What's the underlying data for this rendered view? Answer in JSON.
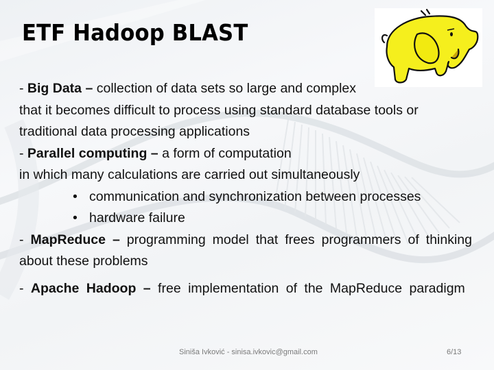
{
  "slide": {
    "title": "ETF Hadoop BLAST",
    "logo": {
      "icon": "hadoop-elephant-icon",
      "color": "#f5ef1d"
    },
    "paragraphs": [
      {
        "term": "Big Data",
        "dash": "–",
        "prefix": "- ",
        "text": " collection of data sets so large and complex",
        "continuation": "that it becomes difficult to process using standard database tools or traditional data processing applications"
      },
      {
        "term": "Parallel computing",
        "dash": "–",
        "prefix": "- ",
        "text": " a form of computation",
        "continuation": "in which many calculations are carried out simultaneously"
      },
      {
        "term": "MapReduce",
        "dash": "–",
        "prefix": "- ",
        "text": " programming model that frees programmers of thinking about these problems"
      },
      {
        "term": "Apache Hadoop",
        "dash": "–",
        "prefix": "- ",
        "text": " free implementation of the MapReduce paradigm"
      }
    ],
    "bullets": [
      "communication and synchronization between processes",
      "hardware failure"
    ],
    "bullet_glyph": "•"
  },
  "footer": {
    "author": "Siniša Ivković - sinisa.ivkovic@gmail.com",
    "page": "6/13"
  }
}
